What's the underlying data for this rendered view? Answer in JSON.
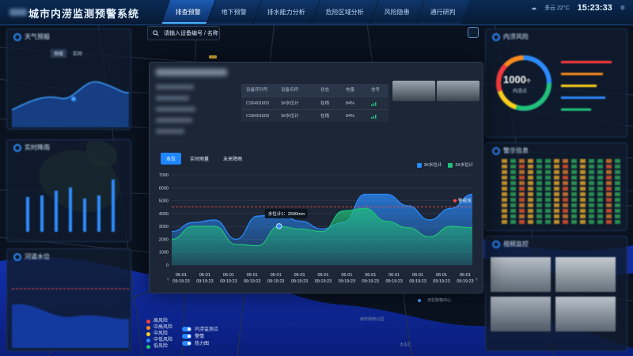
{
  "app": {
    "title": "城市内涝监测预警系统"
  },
  "nav": {
    "tabs": [
      {
        "label": "排查预警",
        "active": true
      },
      {
        "label": "地下预警",
        "active": false
      },
      {
        "label": "排水能力分析",
        "active": false
      },
      {
        "label": "危险区域分析",
        "active": false
      },
      {
        "label": "风险隐患",
        "active": false
      },
      {
        "label": "通行研判",
        "active": false
      }
    ]
  },
  "status": {
    "weather": "多云 22°C",
    "time": "15:23:33"
  },
  "search": {
    "placeholder": "请输入设备编号 / 名称"
  },
  "left_panels": {
    "weather": {
      "title": "天气预报",
      "tabs": [
        "预报",
        "实时"
      ]
    },
    "rain": {
      "title": "实时降雨"
    },
    "river": {
      "title": "河道水位"
    }
  },
  "right_panels": {
    "risk": {
      "title": "内涝风险",
      "center_value": "1000",
      "center_unit": "个",
      "center_label": "内涝点"
    },
    "warning": {
      "title": "警示信息"
    },
    "video": {
      "title": "视频监控"
    }
  },
  "device_table": {
    "headers": [
      "设备序列号",
      "设备名称",
      "状态",
      "电量",
      "信号"
    ],
    "rows": [
      {
        "serial": "CS6401003",
        "name": "3#水位计",
        "status": "在线",
        "battery": "84%"
      },
      {
        "serial": "CS6401003",
        "name": "3#水位计",
        "status": "在线",
        "battery": "84%"
      }
    ]
  },
  "chart_tabs": [
    {
      "label": "水位",
      "active": true
    },
    {
      "label": "实时雨量",
      "active": false
    },
    {
      "label": "未来降雨",
      "active": false
    }
  ],
  "tooltip": {
    "label": "水位计1：2500mm"
  },
  "warning_line_label": "警戒线",
  "chart_data": {
    "type": "area",
    "categories": [
      "06-01 09:19:23",
      "06-01 09:19:23",
      "06-01 09:19:23",
      "06-01 09:19:23",
      "06-01 09:19:23",
      "06-01 09:19:23",
      "06-01 09:19:23",
      "06-01 09:19:23",
      "06-01 09:19:23",
      "06-01 09:19:23",
      "06-01 09:19:23",
      "06-01 09:19:23",
      "06-01 09:19:23"
    ],
    "ylim": [
      0,
      7000
    ],
    "yticks": [
      0,
      1000,
      2000,
      3000,
      4000,
      5000,
      6000,
      7000
    ],
    "warning_value": 4500,
    "series": [
      {
        "name": "3#水位计",
        "color": "#2a8cff",
        "values": [
          2600,
          3300,
          3500,
          2000,
          3800,
          4000,
          3400,
          2800,
          3300,
          5500,
          5500,
          4600,
          3500,
          4400,
          5500
        ]
      },
      {
        "name": "2#水位计",
        "color": "#21c179",
        "values": [
          2000,
          3000,
          3000,
          1600,
          1500,
          3000,
          2800,
          2600,
          4200,
          4400,
          3400,
          2900,
          2200,
          3000,
          2900
        ]
      }
    ]
  },
  "map_legend": {
    "risk_levels": [
      {
        "label": "高风险",
        "color": "#ff3b3b"
      },
      {
        "label": "中高风险",
        "color": "#ff8c1a"
      },
      {
        "label": "中风险",
        "color": "#ffd21a"
      },
      {
        "label": "中低风险",
        "color": "#2c8bff"
      },
      {
        "label": "低风险",
        "color": "#21c179"
      }
    ],
    "layers": [
      "内涝监测点",
      "警情",
      "热力图"
    ]
  },
  "map_labels": [
    "天虹购物中心",
    "太古汇",
    "城市绿地公园"
  ]
}
